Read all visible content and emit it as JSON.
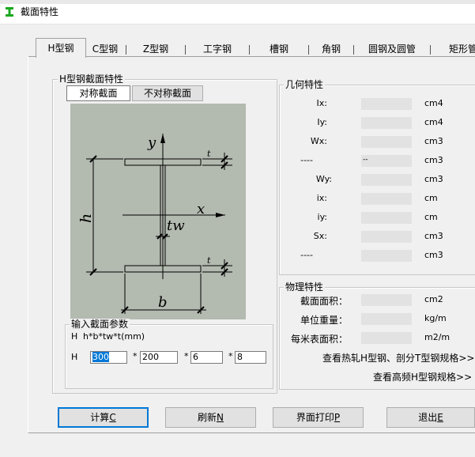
{
  "window": {
    "title": "截面特性"
  },
  "tabs": [
    {
      "label": "H型钢",
      "active": true
    },
    {
      "label": "C型钢"
    },
    {
      "label": "Z型钢"
    },
    {
      "label": "工字钢"
    },
    {
      "label": "槽钢"
    },
    {
      "label": "角钢"
    },
    {
      "label": "圆钢及圆管"
    },
    {
      "label": "矩形管"
    }
  ],
  "section_group": {
    "title": "H型钢截面特性",
    "sym_label": "对称截面",
    "asym_label": "不对称截面"
  },
  "diagram": {
    "labels": {
      "y": "y",
      "x": "x",
      "h": "h",
      "b": "b",
      "tw": "tw",
      "t_top": "t",
      "t_bot": "t"
    }
  },
  "input_group": {
    "title": "输入截面参数",
    "prefix": "H",
    "format": "h*b*tw*t(mm)",
    "row_prefix": "H",
    "h": "300",
    "b": "200",
    "tw": "6",
    "t": "8",
    "sep": "*"
  },
  "geometry": {
    "title": "几何特性",
    "rows": [
      {
        "label": "Ix:",
        "value": "",
        "unit": "cm4"
      },
      {
        "label": "Iy:",
        "value": "",
        "unit": "cm4"
      },
      {
        "label": "Wx:",
        "value": "",
        "unit": "cm3"
      },
      {
        "label": "----",
        "value": "--",
        "unit": "cm3"
      },
      {
        "label": "Wy:",
        "value": "",
        "unit": "cm3"
      },
      {
        "label": "ix:",
        "value": "",
        "unit": "cm"
      },
      {
        "label": "iy:",
        "value": "",
        "unit": "cm"
      },
      {
        "label": "Sx:",
        "value": "",
        "unit": "cm3"
      },
      {
        "label": "----",
        "value": "",
        "unit": "cm3"
      }
    ]
  },
  "physics": {
    "title": "物理特性",
    "rows": [
      {
        "label": "截面面积：",
        "value": "",
        "unit": "cm2"
      },
      {
        "label": "单位重量：",
        "value": "",
        "unit": "kg/m"
      },
      {
        "label": "每米表面积：",
        "value": "",
        "unit": "m2/m"
      }
    ],
    "link1": "查看热轧H型钢、剖分T型钢规格>>",
    "link2": "查看高频H型钢规格>>"
  },
  "buttons": {
    "calc": {
      "text": "计算",
      "key": "C"
    },
    "refresh": {
      "text": "刷新",
      "key": "N"
    },
    "print": {
      "text": "界面打印",
      "key": "P"
    },
    "exit": {
      "text": "退出",
      "key": "E"
    }
  },
  "colors": {
    "accent": "#0078d7",
    "diagram_bg": "#b3bab0",
    "field_bg": "#e2e2e2"
  }
}
